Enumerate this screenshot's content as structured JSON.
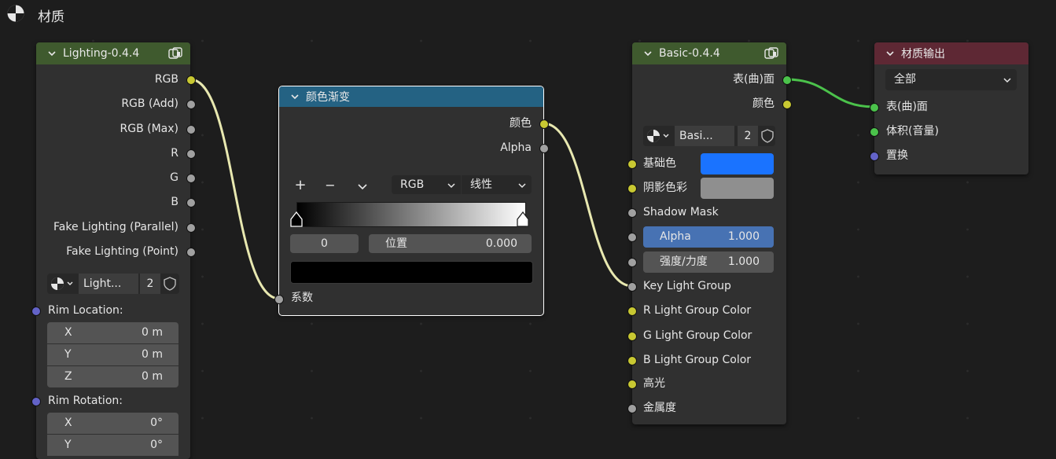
{
  "editor": {
    "title": "材质"
  },
  "colors": {
    "lighting_header": "#3f5a2e",
    "ramp_header": "#246283",
    "basic_header": "#3f5a2e",
    "output_header": "#5e2834",
    "base_color_swatch": "#1a73ff",
    "shadow_color_swatch": "#8f8f8f",
    "wire_color": "#e8e8b0",
    "wire_green": "#4bc24b"
  },
  "lighting_node": {
    "title": "Lighting-0.4.4",
    "outputs": [
      "RGB",
      "RGB (Add)",
      "RGB (Max)",
      "R",
      "G",
      "B",
      "Fake Lighting (Parallel)",
      "Fake Lighting (Point)"
    ],
    "datablock": {
      "name": "Light...",
      "users": "2"
    },
    "rim_location": {
      "label": "Rim Location:",
      "x_label": "X",
      "x": "0 m",
      "y_label": "Y",
      "y": "0 m",
      "z_label": "Z",
      "z": "0 m"
    },
    "rim_rotation": {
      "label": "Rim Rotation:",
      "x_label": "X",
      "x": "0°",
      "y_label": "Y",
      "y": "0°"
    }
  },
  "ramp_node": {
    "title": "颜色渐变",
    "outputs": [
      "颜色",
      "Alpha"
    ],
    "toolbar": {
      "add": "+",
      "remove": "−",
      "more": "",
      "color_mode": "RGB",
      "interpolation": "线性"
    },
    "stop_index": "0",
    "position_label": "位置",
    "position_value": "0.000",
    "input_label": "系数"
  },
  "basic_node": {
    "title": "Basic-0.4.4",
    "outputs": [
      "表(曲)面",
      "颜色"
    ],
    "datablock": {
      "name": "Basi...",
      "users": "2"
    },
    "inputs": {
      "base_color": "基础色",
      "shadow_color": "阴影色彩",
      "shadow_mask": "Shadow Mask",
      "alpha_label": "Alpha",
      "alpha_value": "1.000",
      "strength_label": "强度/力度",
      "strength_value": "1.000",
      "key_light": "Key Light Group",
      "r_light": "R Light Group Color",
      "g_light": "G Light Group Color",
      "b_light": "B Light Group Color",
      "highlight": "高光",
      "metallic": "金属度"
    }
  },
  "output_node": {
    "title": "材质输出",
    "target": "全部",
    "inputs": [
      "表(曲)面",
      "体积(音量)",
      "置换"
    ]
  }
}
